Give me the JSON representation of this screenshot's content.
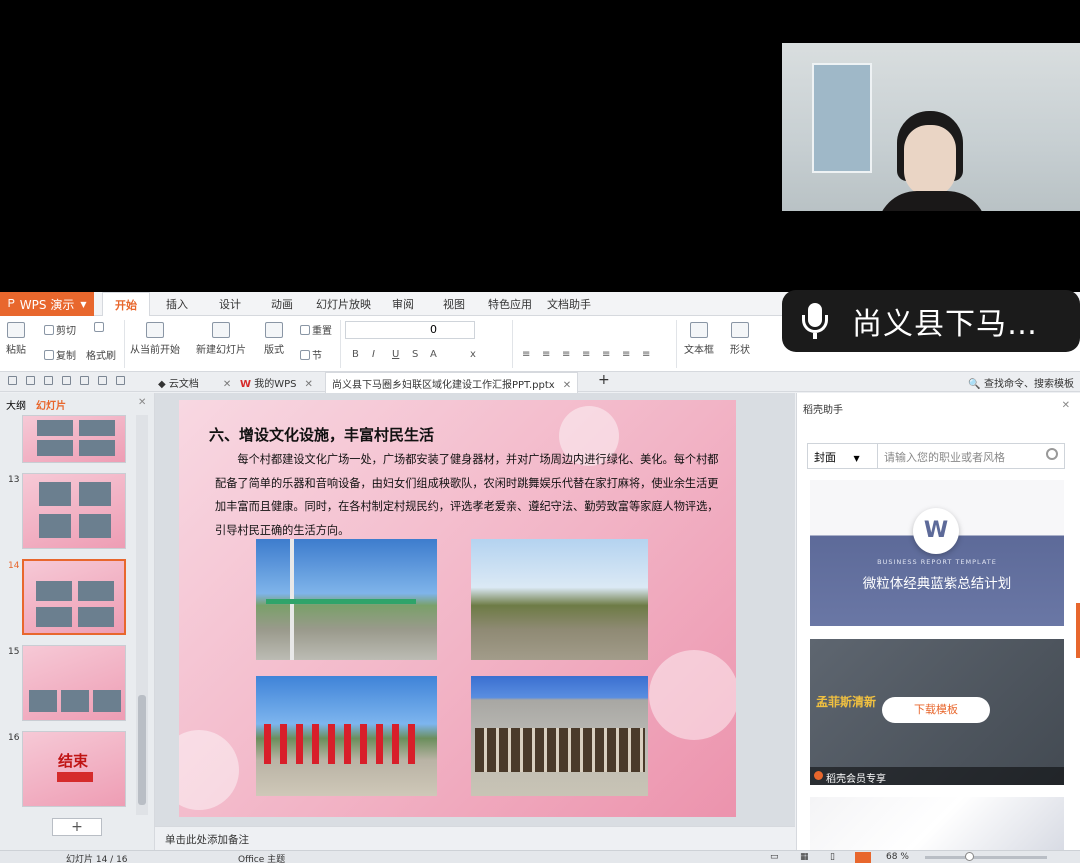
{
  "caption": {
    "text": "尚义县下马…"
  },
  "app": {
    "name": "WPS 演示",
    "ribbon_tabs": [
      "开始",
      "插入",
      "设计",
      "动画",
      "幻灯片放映",
      "审阅",
      "视图",
      "特色应用",
      "文档助手"
    ],
    "active_tab": "开始"
  },
  "ribbon": {
    "paste": "粘贴",
    "cut": "剪切",
    "copy": "复制",
    "format_painter": "格式刷",
    "from_current": "从当前开始",
    "new_slide": "新建幻灯片",
    "layout": "版式",
    "reset": "重置",
    "section": "节",
    "font_size": "0",
    "textbox": "文本框",
    "shape": "形状"
  },
  "docbar": {
    "cloud_doc": "云文档",
    "my_wps": "我的WPS",
    "file_name": "尚义县下马圈乡妇联区域化建设工作汇报PPT.pptx",
    "search_cmd": "查找命令、搜索模板"
  },
  "left_panel": {
    "tab_outline": "大纲",
    "tab_slides": "幻灯片",
    "slide_numbers": [
      "13",
      "14",
      "15",
      "16"
    ],
    "end_slide_title": "结束"
  },
  "slide": {
    "title": "六、增设文化设施，丰富村民生活",
    "paragraph": "每个村都建设文化广场一处，广场都安装了健身器材，并对广场周边内进行绿化、美化。每个村都配备了简单的乐器和音响设备，由妇女们组成秧歌队，农闲时跳舞娱乐代替在家打麻将，使业余生活更加丰富而且健康。同时，在各村制定村规民约，评选孝老爱亲、遵纪守法、勤劳致富等家庭人物评选，引导村民正确的生活方向。"
  },
  "notes": {
    "placeholder": "单击此处添加备注"
  },
  "right_panel": {
    "title": "稻壳助手",
    "category": "封面",
    "search_placeholder": "请输入您的职业或者风格",
    "card1_subtitle": "BUSINESS REPORT TEMPLATE",
    "card1_title": "微粒体经典蓝紫总结计划",
    "card2_brand": "孟菲斯清新",
    "card2_button": "下载模板",
    "card2_badge": "稻壳会员专享"
  },
  "status": {
    "slide_counter": "幻灯片 14 / 16",
    "theme": "Office 主题",
    "zoom": "68 %"
  },
  "colors": {
    "accent": "#e8672d",
    "slide_pink": "#f2b4c6"
  }
}
